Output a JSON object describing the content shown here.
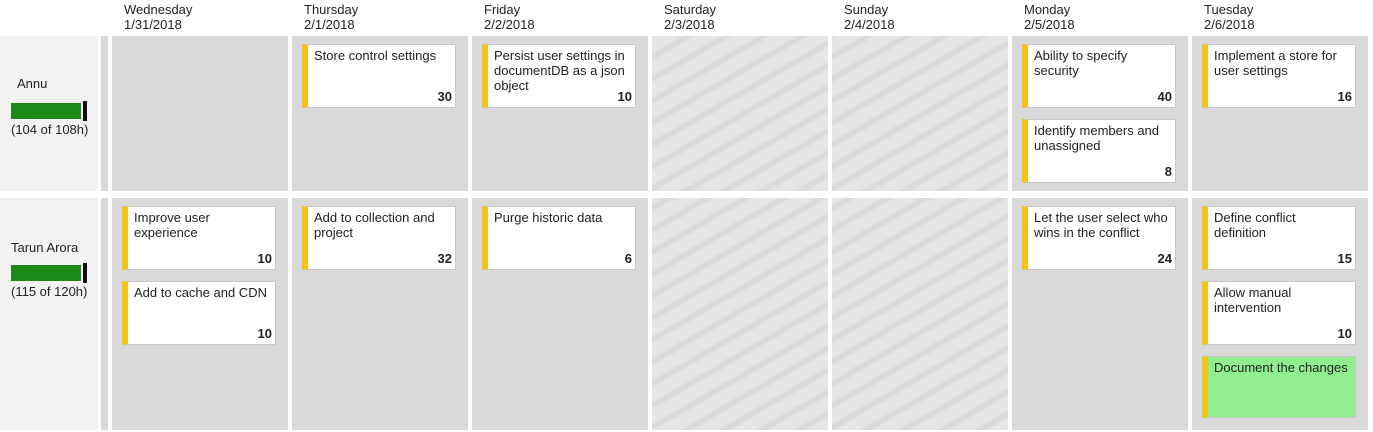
{
  "columns": [
    {
      "day": "Wednesday",
      "date": "1/31/2018"
    },
    {
      "day": "Thursday",
      "date": "2/1/2018"
    },
    {
      "day": "Friday",
      "date": "2/2/2018"
    },
    {
      "day": "Saturday",
      "date": "2/3/2018"
    },
    {
      "day": "Sunday",
      "date": "2/4/2018"
    },
    {
      "day": "Monday",
      "date": "2/5/2018"
    },
    {
      "day": "Tuesday",
      "date": "2/6/2018"
    }
  ],
  "rows": [
    {
      "name": "Annu",
      "hours": "(104 of 108h)",
      "capacity_used_fraction": 0.963,
      "cells": [
        [],
        [
          {
            "title": "Store control settings",
            "estimate": "30"
          }
        ],
        [
          {
            "title": "Persist user settings in documentDB as a json object",
            "estimate": "10"
          }
        ],
        [],
        [],
        [
          {
            "title": "Ability to specify security",
            "estimate": "40"
          },
          {
            "title": "Identify members and unassigned",
            "estimate": "8"
          }
        ],
        [
          {
            "title": "Implement a store for user settings",
            "estimate": "16"
          }
        ]
      ]
    },
    {
      "name": "Tarun Arora",
      "hours": "(115 of 120h)",
      "capacity_used_fraction": 0.958,
      "cells": [
        [
          {
            "title": "Improve user experience",
            "estimate": "10"
          },
          {
            "title": "Add to cache and CDN",
            "estimate": "10"
          }
        ],
        [
          {
            "title": "Add to collection and project",
            "estimate": "32"
          }
        ],
        [
          {
            "title": "Purge historic data",
            "estimate": "6"
          }
        ],
        [],
        [],
        [
          {
            "title": "Let the user select who wins in the conflict",
            "estimate": "24"
          }
        ],
        [
          {
            "title": "Define conflict definition",
            "estimate": "15"
          },
          {
            "title": "Allow manual intervention",
            "estimate": "10"
          },
          {
            "title": "Document the changes",
            "estimate": "",
            "highlight": true
          }
        ]
      ]
    }
  ],
  "colors": {
    "card_stripe": "#f0c419",
    "capacity_bar": "#1a8a1a",
    "highlight_card": "#90ee90",
    "cell_bg": "#d9d9d9"
  }
}
